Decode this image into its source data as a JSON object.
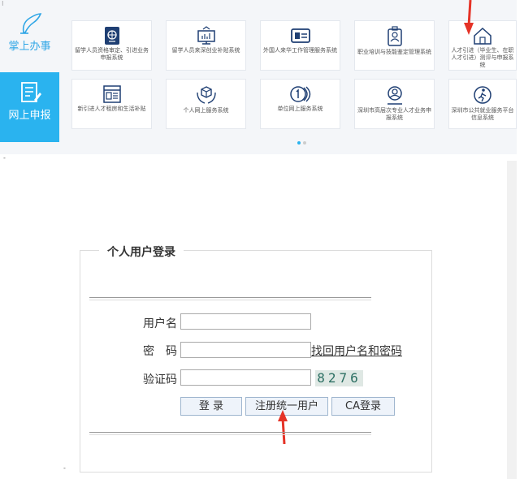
{
  "sidebar": {
    "items": [
      {
        "label": "掌上办事"
      },
      {
        "label": "网上申报"
      }
    ]
  },
  "services": [
    {
      "label": "留学人员资格审定、引进业务申报系统"
    },
    {
      "label": "留学人员来深创业补贴系统"
    },
    {
      "label": "外国人来华工作管理服务系统"
    },
    {
      "label": "职业培训与技能鉴定管理系统"
    },
    {
      "label": "人才引进（毕业生、在职人才引进）测评与申报系统"
    },
    {
      "label": "新引进人才租房和生活补贴"
    },
    {
      "label": "个人网上服务系统"
    },
    {
      "label": "单位网上服务系统"
    },
    {
      "label": "深圳市高层次专业人才业务申报系统"
    },
    {
      "label": "深圳市公共就业服务平台信息系统"
    }
  ],
  "carousel": {
    "active_index": 0,
    "total": 2
  },
  "login": {
    "title": "个人用户登录",
    "username_label": "用户名",
    "username_value": "",
    "password_label": "密　码",
    "password_value": "",
    "recover_link": "找回用户名和密码",
    "captcha_label": "验证码",
    "captcha_value": "",
    "captcha_text": "8276",
    "login_button": "登 录",
    "register_button": "注册统一用户",
    "ca_button": "CA登录"
  },
  "colors": {
    "accent": "#2ab3ef",
    "annotation_arrow": "#e53327"
  }
}
